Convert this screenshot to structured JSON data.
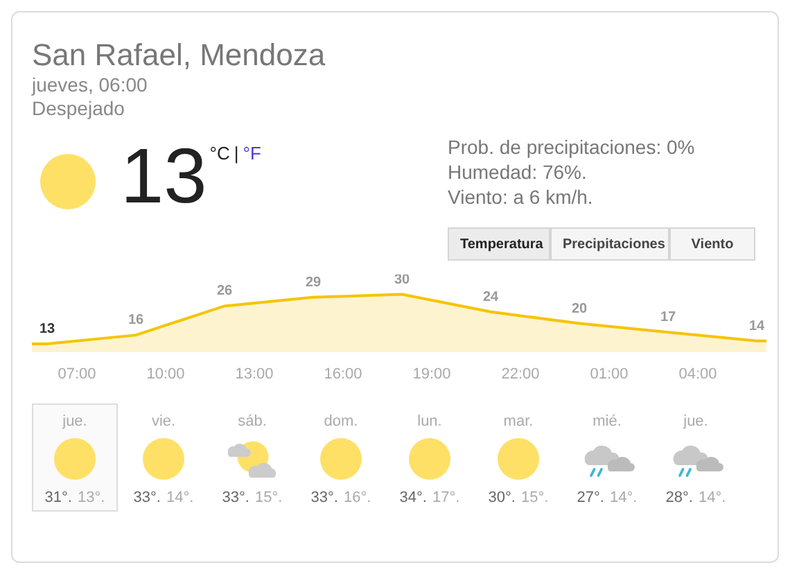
{
  "location": "San Rafael, Mendoza",
  "time": "jueves, 06:00",
  "condition": "Despejado",
  "current": {
    "kind": "sun",
    "temperature": "13",
    "units": [
      {
        "label": "°C",
        "selected": true
      },
      {
        "label": "°F",
        "selected": false
      }
    ],
    "separator": "|"
  },
  "details": [
    "Prob. de precipitaciones: 0%",
    "Humedad: 76%.",
    "Viento: a 6 km/h."
  ],
  "tabs": [
    {
      "label": "Temperatura",
      "selected": true
    },
    {
      "label": "Precipitaciones",
      "selected": false
    },
    {
      "label": "Viento",
      "selected": false
    }
  ],
  "chart": {
    "chart_data": {
      "type": "area",
      "series": [
        {
          "color": "#f5c400",
          "values": [
            13,
            16,
            26,
            29,
            30,
            24,
            20,
            17,
            14
          ]
        }
      ],
      "data_labels": true
    }
  },
  "hours": [
    "07:00",
    "10:00",
    "13:00",
    "16:00",
    "19:00",
    "22:00",
    "01:00",
    "04:00"
  ],
  "days": [
    {
      "day": "jue.",
      "kind": "sun",
      "high": "31°.",
      "low": "13°.",
      "selected": true
    },
    {
      "day": "vie.",
      "kind": "sun",
      "high": "33°.",
      "low": "14°.",
      "selected": false
    },
    {
      "day": "sáb.",
      "kind": "partly_cloudy",
      "high": "33°.",
      "low": "15°.",
      "selected": false
    },
    {
      "day": "dom.",
      "kind": "sun",
      "high": "33°.",
      "low": "16°.",
      "selected": false
    },
    {
      "day": "lun.",
      "kind": "sun",
      "high": "34°.",
      "low": "17°.",
      "selected": false
    },
    {
      "day": "mar.",
      "kind": "sun",
      "high": "30°.",
      "low": "15°.",
      "selected": false
    },
    {
      "day": "mié.",
      "kind": "rain",
      "high": "27°.",
      "low": "14°.",
      "selected": false
    },
    {
      "day": "jue.",
      "kind": "rain",
      "high": "28°.",
      "low": "14°.",
      "selected": false
    }
  ]
}
